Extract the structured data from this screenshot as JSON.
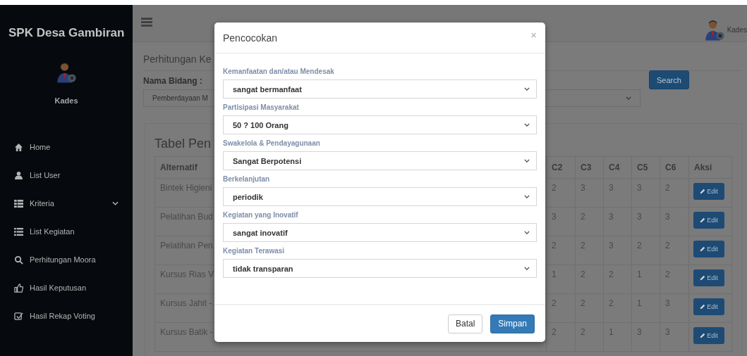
{
  "sidebar": {
    "brand": "SPK Desa Gambiran",
    "user_name": "Kades",
    "items": [
      {
        "label": "Home",
        "expandable": false
      },
      {
        "label": "List User",
        "expandable": false
      },
      {
        "label": "Kriteria",
        "expandable": true
      },
      {
        "label": "List Kegiatan",
        "expandable": false
      },
      {
        "label": "Perhitungan Moora",
        "expandable": false
      },
      {
        "label": "Hasil Keputusan",
        "expandable": false
      },
      {
        "label": "Hasil Rekap Voting",
        "expandable": false
      }
    ]
  },
  "topbar": {
    "user_name": "Kades"
  },
  "content": {
    "heading": "Perhitungan Ke",
    "field_label": "Nama Bidang :",
    "select_value": "Pemberdayaan M",
    "search_button": "Search"
  },
  "table": {
    "title": "Tabel Pen",
    "columns": [
      "Alternatif",
      "C2",
      "C3",
      "C4",
      "C5",
      "C6",
      "Aksi"
    ],
    "rows": [
      {
        "alternatif": "Bintek Higieni",
        "values": [
          "2",
          "3",
          "3",
          "3",
          "2"
        ],
        "action": "Edit"
      },
      {
        "alternatif": "Pelatihan Bud",
        "values": [
          "3",
          "2",
          "3",
          "3",
          "3"
        ],
        "action": "Edit"
      },
      {
        "alternatif": "Pelatihan Pen",
        "values": [
          "2",
          "2",
          "3",
          "2",
          "2"
        ],
        "action": "Edit"
      },
      {
        "alternatif": "Kursus Rias V",
        "values": [
          "1",
          "2",
          "2",
          "1",
          "2"
        ],
        "action": "Edit"
      },
      {
        "alternatif": "Kursus Jahit -",
        "values": [
          "2",
          "2",
          "2",
          "1",
          "3"
        ],
        "action": "Edit"
      },
      {
        "alternatif": "Kursus Batik -",
        "values": [
          "2",
          "2",
          "1",
          "3",
          "3"
        ],
        "action": "Edit"
      }
    ]
  },
  "modal": {
    "title": "Pencocokan",
    "close": "×",
    "fields": [
      {
        "label": "Kemanfaatan dan/atau Mendesak",
        "value": "sangat bermanfaat"
      },
      {
        "label": "Partisipasi Masyarakat",
        "value": "50 ? 100 Orang"
      },
      {
        "label": "Swakelola & Pendayagunaan",
        "value": "Sangat Berpotensi"
      },
      {
        "label": "Berkelanjutan",
        "value": "periodik"
      },
      {
        "label": "Kegiatan yang Inovatif",
        "value": "sangat inovatif"
      },
      {
        "label": "Kegiatan Terawasi",
        "value": "tidak transparan"
      }
    ],
    "buttons": [
      {
        "label": "Batal",
        "kind": "default"
      },
      {
        "label": "Simpan",
        "kind": "primary"
      }
    ]
  }
}
